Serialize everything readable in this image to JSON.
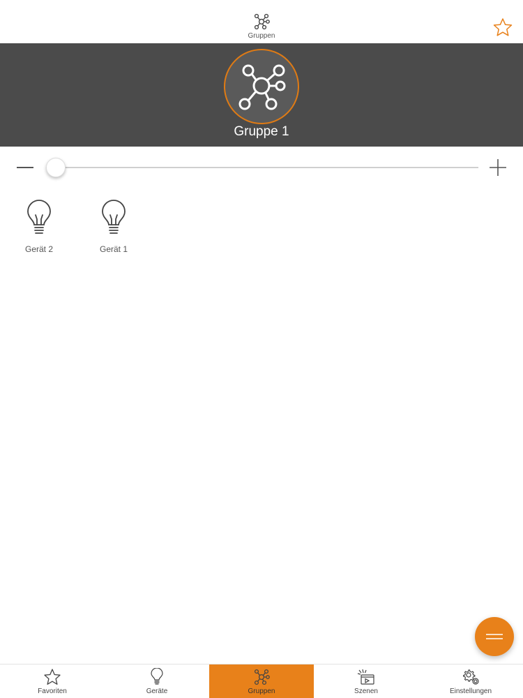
{
  "topnav": {
    "title": "Gruppen"
  },
  "group": {
    "name": "Gruppe 1"
  },
  "slider": {
    "value_fraction": 0.02
  },
  "devices": [
    {
      "label": "Gerät 2"
    },
    {
      "label": "Gerät 1"
    }
  ],
  "tabs": [
    {
      "label": "Favoriten",
      "icon": "star-icon"
    },
    {
      "label": "Geräte",
      "icon": "bulb-icon"
    },
    {
      "label": "Gruppen",
      "icon": "network-icon",
      "active": true
    },
    {
      "label": "Szenen",
      "icon": "scene-icon"
    },
    {
      "label": "Einstellungen",
      "icon": "gear-icon"
    }
  ],
  "colors": {
    "accent": "#e8811a",
    "header": "#4b4b4b"
  }
}
